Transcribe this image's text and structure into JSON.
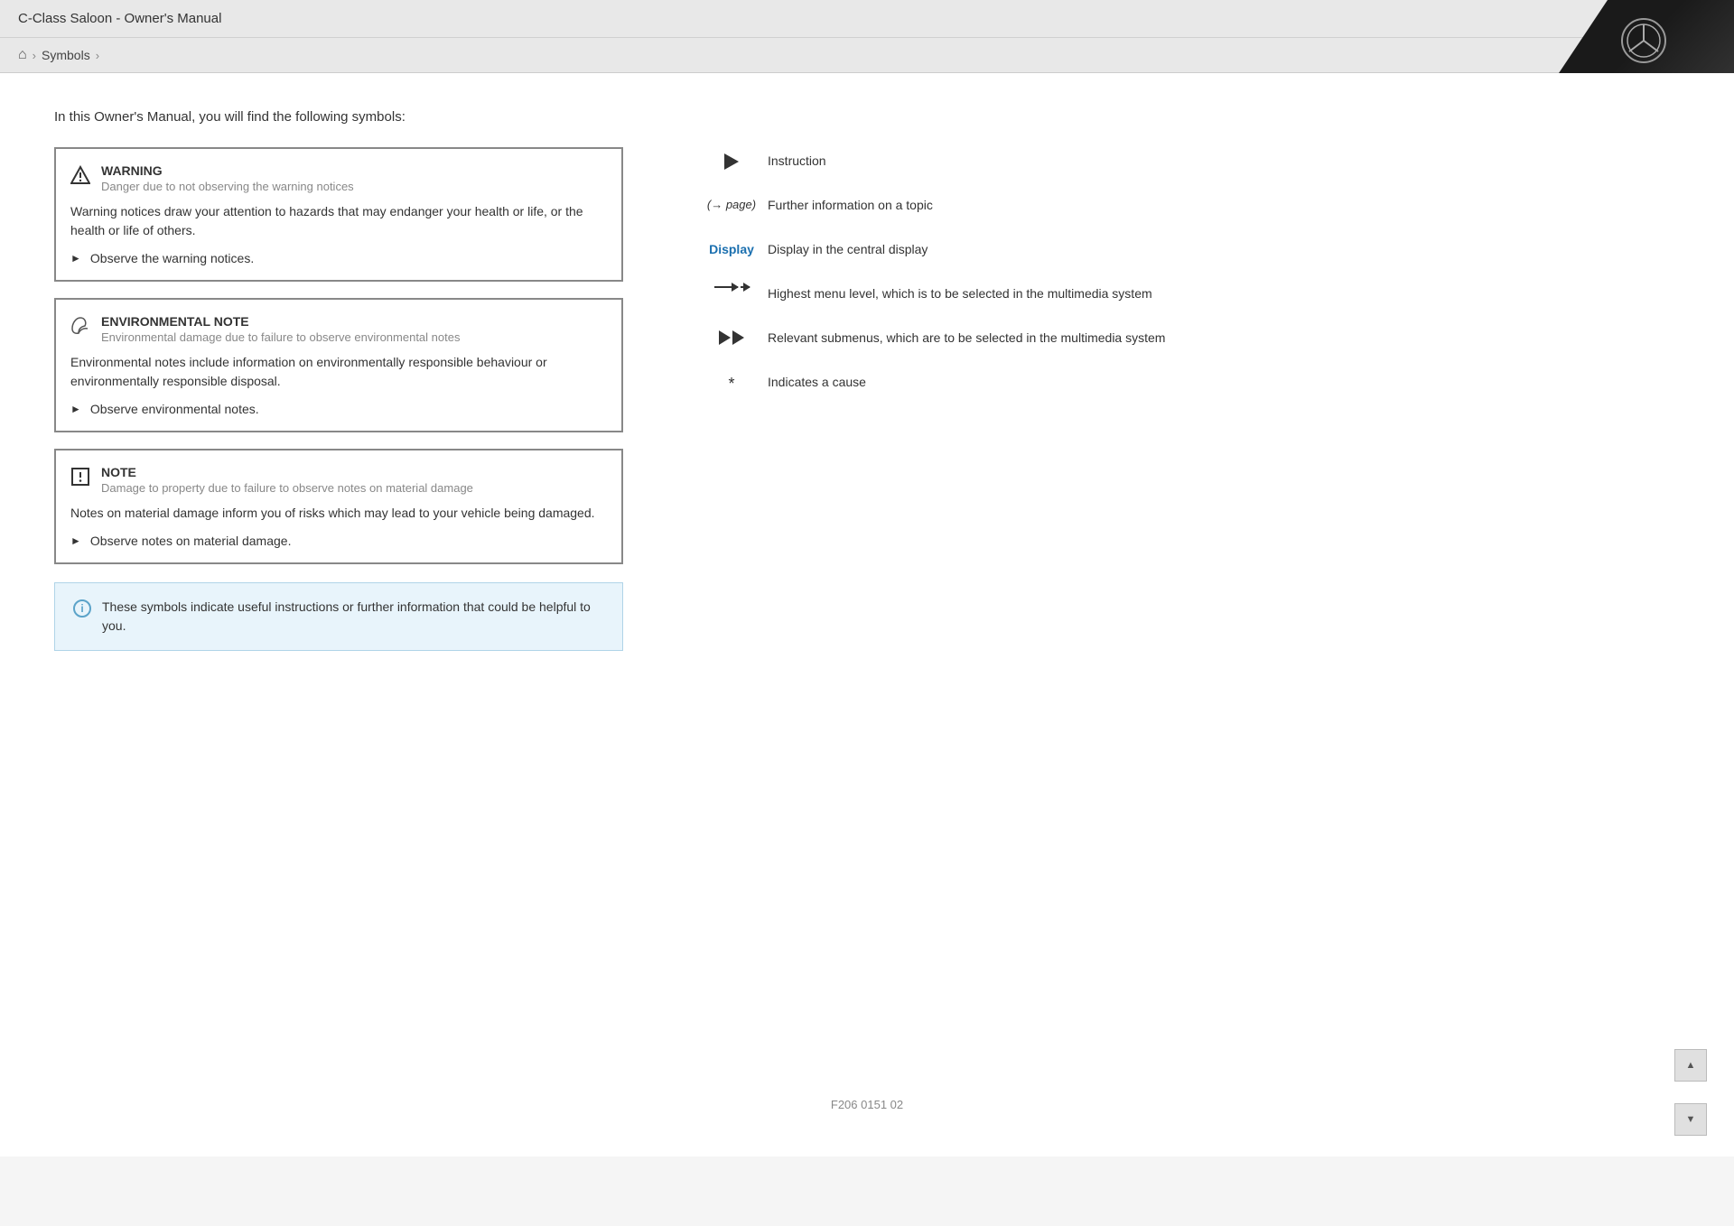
{
  "header": {
    "title": "C-Class Saloon - Owner's Manual",
    "logo_alt": "Mercedes-Benz Logo"
  },
  "breadcrumb": {
    "home_icon": "⌂",
    "separator": ">",
    "items": [
      "Symbols",
      ">"
    ]
  },
  "intro": {
    "text": "In this Owner's Manual, you will find the following symbols:"
  },
  "notices": [
    {
      "type": "warning",
      "title": "WARNING",
      "subtitle": "Danger due to not observing the warning notices",
      "body": "Warning notices draw your attention to hazards that may endanger your health or life, or the health or life of others.",
      "instruction": "Observe the warning notices."
    },
    {
      "type": "environmental",
      "title": "ENVIRONMENTAL NOTE",
      "subtitle": "Environmental damage due to failure to observe environmental notes",
      "body": "Environmental notes include information on environmentally responsible behaviour or environmentally responsible disposal.",
      "instruction": "Observe environmental notes."
    },
    {
      "type": "note",
      "title": "NOTE",
      "subtitle": "Damage to property due to failure to observe notes on material damage",
      "body": "Notes on material damage inform you of risks which may lead to your vehicle being damaged.",
      "instruction": "Observe notes on material damage."
    }
  ],
  "info_box": {
    "text": "These symbols indicate useful instructions or further information that could be helpful to you."
  },
  "symbols": [
    {
      "icon_type": "play",
      "description": "Instruction"
    },
    {
      "icon_type": "page_ref",
      "icon_text": "(→ page)",
      "description": "Further information on a topic"
    },
    {
      "icon_type": "display",
      "icon_text": "Display",
      "description": "Display in the central display"
    },
    {
      "icon_type": "arrow_menu",
      "description": "Highest menu level, which is to be selected in the multimedia system"
    },
    {
      "icon_type": "double_arrow",
      "description": "Relevant submenus, which are to be selected in the multimedia system"
    },
    {
      "icon_type": "asterisk",
      "icon_text": "*",
      "description": "Indicates a cause"
    }
  ],
  "footer": {
    "text": "F206 0151 02"
  },
  "scroll": {
    "up_label": "▲",
    "down_label": "▼"
  }
}
